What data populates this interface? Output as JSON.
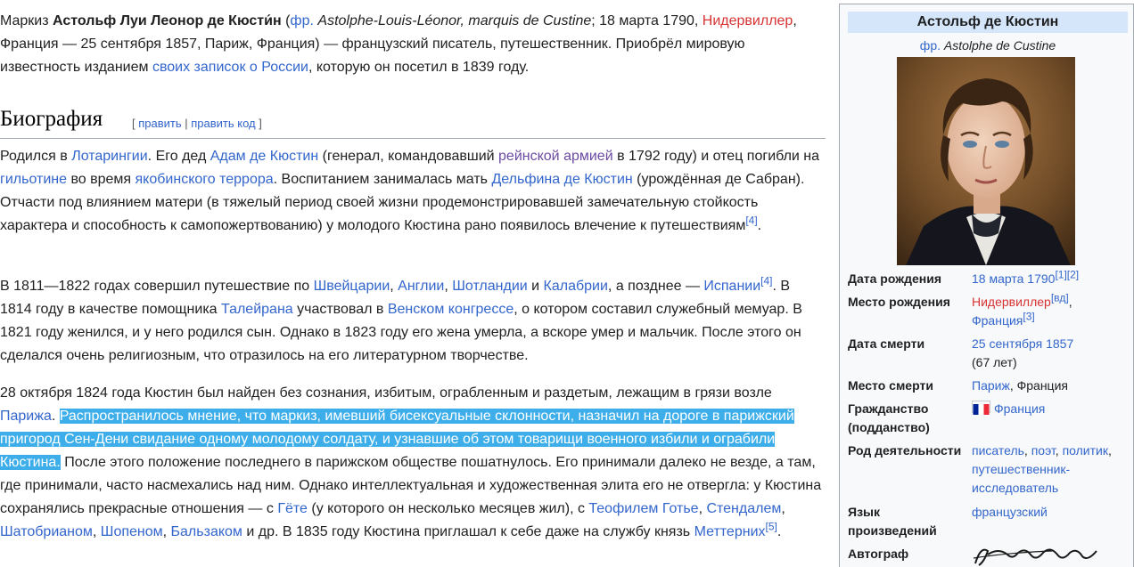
{
  "intro": {
    "t1": "Маркиз ",
    "name_bold": "Астольф Луи Леонор де Кюсти́н",
    "t2": " (",
    "lang_link": "фр.",
    "t3": " ",
    "name_fr": "Astolphe-Louis-Léonor, marquis de Custine",
    "t4": "; 18 марта 1790, ",
    "birthplace_link": "Нидервиллер",
    "t5": ", Франция — 25 сентября 1857, Париж, Франция) — французский писатель, путешественник. Приобрёл мировую известность изданием ",
    "notes_link": "своих записок о России",
    "t6": ", которую он посетил в 1839 году."
  },
  "heading": {
    "title": "Биография",
    "bracket_open": "[ ",
    "edit": "править",
    "sep": " | ",
    "edit_code": "править код",
    "bracket_close": " ]"
  },
  "p1": {
    "a": "Родился в ",
    "l1": "Лотарингии",
    "b": ". Его дед ",
    "l2": "Адам де Кюстин",
    "c": " (генерал, командовавший ",
    "l3": "рейнской армией",
    "d": " в 1792 году) и отец погибли на ",
    "l4": "гильотине",
    "e": " во время ",
    "l5": "якобинского террора",
    "f": ". Воспитанием занималась мать ",
    "l6": "Дельфина де Кюстин",
    "g": " (урождённая де Сабран). Отчасти под влиянием матери (в тяжелый период своей жизни продемонстрировавшей замечательную стойкость характера и способность к самопожертвованию) у молодого Кюстина рано появилось влечение к путешествиям",
    "ref": "[4]",
    "h": "."
  },
  "p2": {
    "a": "В 1811—1822 годах совершил путешествие по ",
    "l1": "Швейцарии",
    "b": ", ",
    "l2": "Англии",
    "c": ", ",
    "l3": "Шотландии",
    "d": " и ",
    "l4": "Калабрии",
    "e": ", а позднее — ",
    "l5": "Испании",
    "ref": "[4]",
    "f": ". В 1814 году в качестве помощника ",
    "l6": "Талейрана",
    "g": " участвовал в ",
    "l7": "Венском конгрессе",
    "h": ", о котором составил служебный мемуар. В 1821 году женился, и у него родился сын. Однако в 1823 году его жена умерла, а вскоре умер и мальчик. После этого он сделался очень религиозным, что отразилось на его литературном творчестве."
  },
  "p3": {
    "a": "28 октября 1824 года Кюстин был найден без сознания, избитым, ограбленным и раздетым, лежащим в грязи возле ",
    "l1": "Парижа",
    "b": ". ",
    "highlight": "Распространилось мнение, что маркиз, имевший бисексуальные склонности, назначил на дороге в парижский пригород Сен-Дени свидание одному молодому солдату, и узнавшие об этом товарищи военного избили и ограбили Кюстина.",
    "c": " После этого положение последнего в парижском обществе пошатнулось. Его принимали далеко не везде, а там, где принимали, часто насмехались над ним. Однако интеллектуальная и художественная элита его не отвергла: у Кюстина сохранялись прекрасные отношения — с ",
    "l2": "Гёте",
    "d": " (у которого он несколько месяцев жил), с ",
    "l3": "Теофилем Готье",
    "e": ", ",
    "l4": "Стендалем",
    "f": ", ",
    "l5": "Шатобрианом",
    "g": ", ",
    "l6": "Шопеном",
    "h": ", ",
    "l7": "Бальзаком",
    "i": " и др. В 1835 году Кюстина приглашал к себе даже на службу князь ",
    "l8": "Меттерних",
    "ref": "[5]",
    "j": "."
  },
  "infobox": {
    "title": "Астольф де Кюстин",
    "sub_lang": "фр.",
    "sub_name": " Astolphe de Custine",
    "birth_date_label": "Дата рождения",
    "birth_date": "18 марта 1790",
    "birth_date_refs": "[1][2]",
    "birth_place_label": "Место рождения",
    "birth_place": "Нидервиллер",
    "birth_place_ref": "[вд]",
    "birth_place_comma": ",",
    "birth_country": "Франция",
    "birth_country_ref": "[3]",
    "death_date_label": "Дата смерти",
    "death_date": "25 сентября 1857",
    "death_age": "(67 лет)",
    "death_place_label": "Место смерти",
    "death_place": "Париж",
    "death_place_rest": ", Франция",
    "citizenship_label": "Гражданство (подданство)",
    "citizenship": "Франция",
    "occupation_label": "Род деятельности",
    "occ1": "писатель",
    "occ_sep1": ", ",
    "occ2": "поэт",
    "occ_sep2": ", ",
    "occ3": "политик",
    "occ_sep3": ", ",
    "occ4": "путешественник-исследователь",
    "language_label": "Язык произведений",
    "language": "французский",
    "autograph_label": "Автограф"
  },
  "colors": {
    "link": "#3366cc",
    "redlink": "#d73333",
    "visited": "#6b4ba1",
    "highlight": "#3daee9",
    "infobox_title_bg": "#d6e6fa"
  }
}
